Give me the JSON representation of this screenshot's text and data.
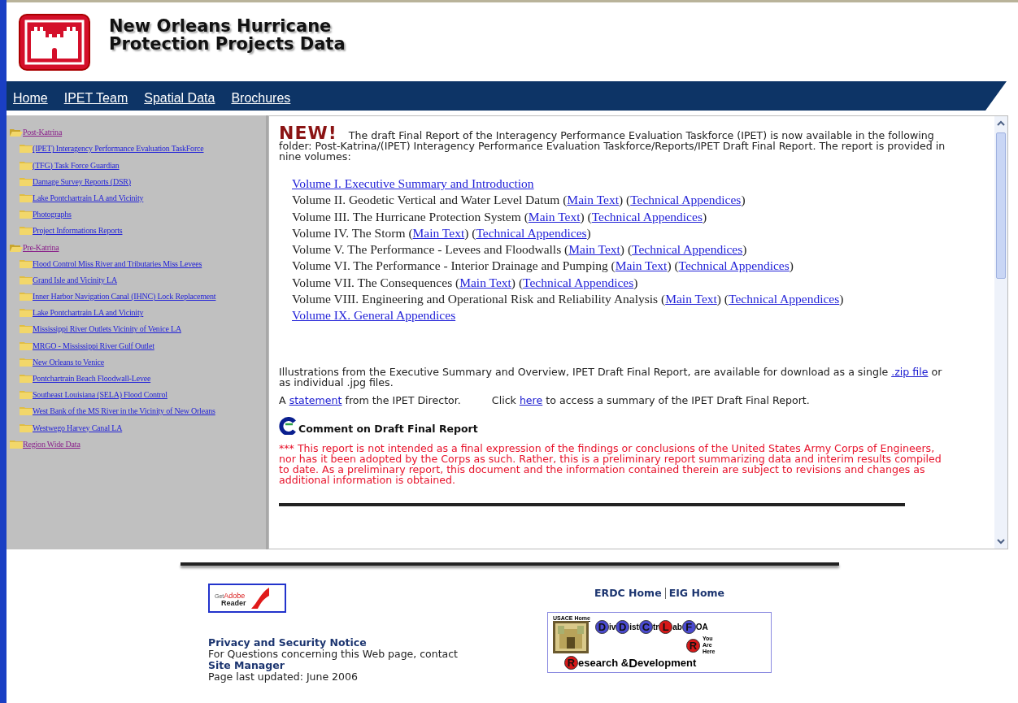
{
  "header": {
    "title_lines": [
      "New Orleans Hurricane",
      "Protection Projects Data"
    ]
  },
  "nav": [
    {
      "label": "Home"
    },
    {
      "label": "IPET Team"
    },
    {
      "label": "Spatial Data"
    },
    {
      "label": "Brochures"
    }
  ],
  "sidebar": {
    "items": [
      {
        "label": " Post-Katrina",
        "expanded": true,
        "children": [
          {
            "label": "(IPET) Interagency Performance Evaluation TaskForce"
          },
          {
            "label": "(TFG) Task Force Guardian"
          },
          {
            "label": "Damage Survey Reports (DSR)"
          },
          {
            "label": "Lake Pontchartrain LA and Vicinity"
          },
          {
            "label": "Photographs"
          },
          {
            "label": "Project Informations Reports"
          }
        ]
      },
      {
        "label": " Pre-Katrina",
        "expanded": true,
        "children": [
          {
            "label": "Flood Control Miss River and Tributaries Miss Levees"
          },
          {
            "label": "Grand Isle and Vicinity LA"
          },
          {
            "label": "Inner Harbor Navigation Canal (IHNC) Lock Replacement"
          },
          {
            "label": "Lake Pontchartrain LA and Vicinity"
          },
          {
            "label": "Mississippi River Outlets Vicinity of Venice LA"
          },
          {
            "label": "MRGO - Mississippi River Gulf Outlet"
          },
          {
            "label": "New Orleans to Venice"
          },
          {
            "label": "Pontchartrain Beach Floodwall-Levee"
          },
          {
            "label": "Southeast Louisiana (SELA) Flood Control"
          },
          {
            "label": "West Bank of the MS River in the Vicinity of New Orleans"
          },
          {
            "label": "Westwego Harvey Canal LA"
          }
        ]
      },
      {
        "label": " Region Wide Data",
        "expanded": false
      }
    ]
  },
  "content": {
    "badge": "NEW!",
    "intro": "The draft Final Report of the Interagency Performance Evaluation Taskforce (IPET) is now available in the following folder: Post-Katrina/(IPET) Interagency Performance Evaluation Taskforce/Reports/IPET Draft Final Report. The report is provided in nine volumes:",
    "volumes": [
      [
        {
          "kind": "link",
          "text": "Volume I. Executive Summary and Introduction"
        }
      ],
      [
        {
          "kind": "text",
          "text": "Volume II. Geodetic Vertical and Water Level Datum ("
        },
        {
          "kind": "link",
          "text": "Main Text"
        },
        {
          "kind": "text",
          "text": ") ("
        },
        {
          "kind": "link",
          "text": "Technical Appendices"
        },
        {
          "kind": "text",
          "text": ")"
        }
      ],
      [
        {
          "kind": "text",
          "text": "Volume III. The Hurricane Protection System ("
        },
        {
          "kind": "link",
          "text": "Main Text"
        },
        {
          "kind": "text",
          "text": ") ("
        },
        {
          "kind": "link",
          "text": "Technical Appendices"
        },
        {
          "kind": "text",
          "text": ")"
        }
      ],
      [
        {
          "kind": "text",
          "text": "Volume IV. The Storm ("
        },
        {
          "kind": "link",
          "text": "Main Text"
        },
        {
          "kind": "text",
          "text": ") ("
        },
        {
          "kind": "link",
          "text": "Technical Appendices"
        },
        {
          "kind": "text",
          "text": ")"
        }
      ],
      [
        {
          "kind": "text",
          "text": "Volume V. The Performance - Levees and Floodwalls ("
        },
        {
          "kind": "link",
          "text": "Main Text"
        },
        {
          "kind": "text",
          "text": ") ("
        },
        {
          "kind": "link",
          "text": "Technical Appendices"
        },
        {
          "kind": "text",
          "text": ")"
        }
      ],
      [
        {
          "kind": "text",
          "text": "Volume VI. The Performance - Interior Drainage and Pumping ("
        },
        {
          "kind": "link",
          "text": "Main Text"
        },
        {
          "kind": "text",
          "text": ") ("
        },
        {
          "kind": "link",
          "text": "Technical Appendices"
        },
        {
          "kind": "text",
          "text": ")"
        }
      ],
      [
        {
          "kind": "text",
          "text": "Volume VII. The Consequences ("
        },
        {
          "kind": "link",
          "text": "Main Text"
        },
        {
          "kind": "text",
          "text": ") ("
        },
        {
          "kind": "link",
          "text": "Technical Appendices"
        },
        {
          "kind": "text",
          "text": ")"
        }
      ],
      [
        {
          "kind": "text",
          "text": "Volume VIII. Engineering and Operational Risk and Reliability Analysis ("
        },
        {
          "kind": "link",
          "text": "Main Text"
        },
        {
          "kind": "text",
          "text": ") ("
        },
        {
          "kind": "link",
          "text": "Technical Appendices"
        },
        {
          "kind": "text",
          "text": ")"
        }
      ],
      [
        {
          "kind": "link",
          "text": "Volume IX. General Appendices"
        }
      ]
    ],
    "paragraphs": [
      [
        {
          "kind": "text",
          "text": "Illustrations from the Executive Summary and Overview, IPET Draft Final Report, are available for download as a single "
        },
        {
          "kind": "link",
          "text": ".zip file"
        },
        {
          "kind": "text",
          "text": " or as individual .jpg files."
        }
      ],
      [
        {
          "kind": "text",
          "text": "A "
        },
        {
          "kind": "link",
          "text": "statement"
        },
        {
          "kind": "text",
          "text": " from the IPET Director."
        },
        {
          "kind": "gap"
        },
        {
          "kind": "text",
          "text": "Click "
        },
        {
          "kind": "link",
          "text": "here"
        },
        {
          "kind": "text",
          "text": " to access a summary of the IPET Draft Final Report."
        }
      ]
    ],
    "comment_link": "Comment on Draft Final Report",
    "disclaimer": "*** This report is not intended as a final expression of the findings or conclusions of the United States Army Corps of Engineers, nor has it been adopted by the Corps as such. Rather, this is a preliminary report summarizing data and interim results compiled to date. As a preliminary report, this document and the information contained therein are subject to revisions and changes as additional information is obtained."
  },
  "footer": {
    "adobe": {
      "small": "Get",
      "brand": "Adobe",
      "product": "Reader"
    },
    "home_links": [
      "ERDC Home",
      "EIG Home"
    ],
    "privacy": "Privacy and Security Notice",
    "contact": "For Questions concerning this Web page, contact",
    "manager": "Site Manager",
    "updated": "Page last updated: June 2006",
    "diagram": {
      "home_label": "USACE Home",
      "levels": [
        {
          "letter": "D",
          "rest": "iv",
          "color": "#4a4ad0"
        },
        {
          "letter": "D",
          "rest": "ist",
          "color": "#4a4ad0"
        },
        {
          "letter": "C",
          "rest": "tr",
          "color": "#4a4ad0"
        },
        {
          "letter": "L",
          "rest": "ab",
          "color": "#d81818"
        },
        {
          "letter": "F",
          "rest": "OA",
          "color": "#4a4ad0"
        }
      ],
      "current": "R",
      "note": "You Are Here",
      "bottom_letter": "R",
      "bottom_rest": "esearch & ",
      "bottom_letter2": "D",
      "bottom_rest2": "evelopment"
    }
  }
}
